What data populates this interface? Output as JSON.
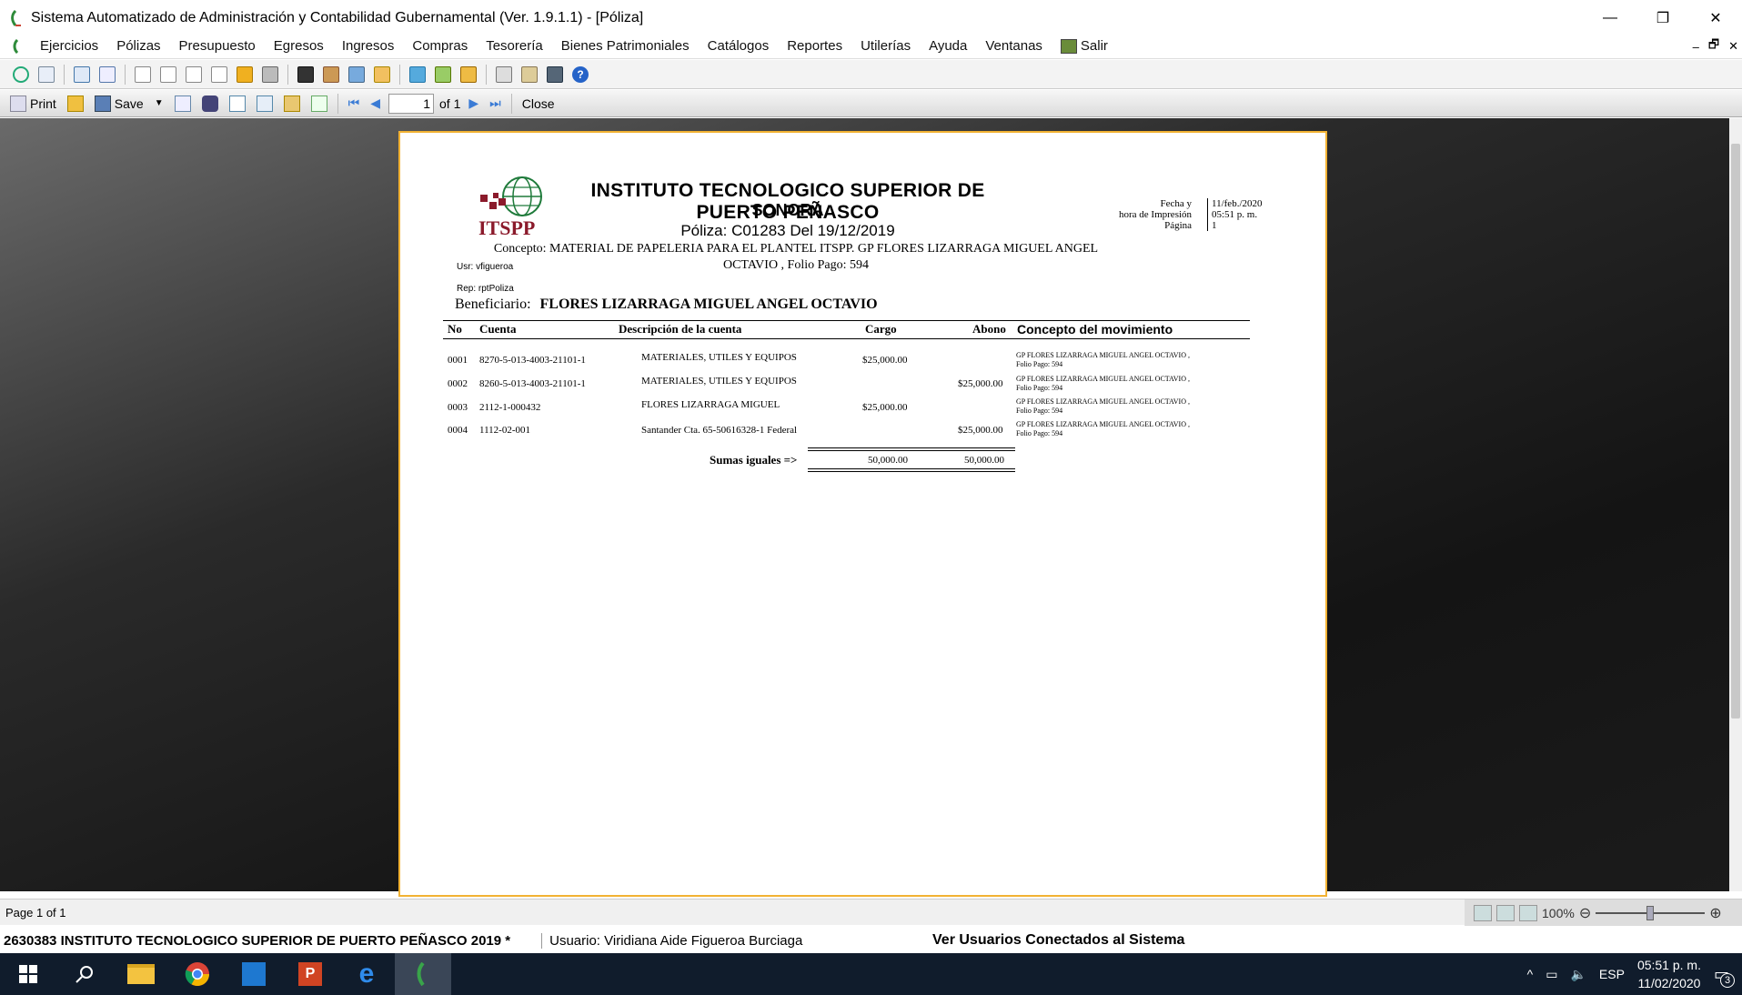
{
  "window": {
    "title": "Sistema Automatizado de Administración y Contabilidad Gubernamental  (Ver. 1.9.1.1) - [Póliza]",
    "minimize": "—",
    "restore": "❐",
    "close": "✕"
  },
  "menu": {
    "items": [
      "Ejercicios",
      "Pólizas",
      "Presupuesto",
      "Egresos",
      "Ingresos",
      "Compras",
      "Tesorería",
      "Bienes Patrimoniales",
      "Catálogos",
      "Reportes",
      "Utilerías",
      "Ayuda",
      "Ventanas",
      "Salir"
    ],
    "mdi_minimize": "–",
    "mdi_restore": "🗗",
    "mdi_close": "✕"
  },
  "report_toolbar": {
    "print": "Print",
    "save": "Save",
    "page_value": "1",
    "of_pages": "of 1",
    "close": "Close"
  },
  "report": {
    "institution": "INSTITUTO TECNOLOGICO SUPERIOR DE PUERTO PEÑASCO",
    "state": "SONORA",
    "poliza_line": "Póliza:  C01283  Del 19/12/2019",
    "logo_text": "ITSPP",
    "meta_labels": [
      "Fecha y",
      "hora de Impresión",
      "Página"
    ],
    "meta_values": [
      "11/feb./2020",
      "05:51 p. m.",
      "1"
    ],
    "concepto_label": "Concepto:",
    "concepto_text": " MATERIAL DE PAPELERIA PARA EL PLANTEL ITSPP. GP FLORES LIZARRAGA MIGUEL ANGEL OCTAVIO , Folio Pago: 594",
    "usr": "Usr: vfigueroa",
    "rep": "Rep: rptPoliza",
    "beneficiario_label": "Beneficiario:",
    "beneficiario": "FLORES LIZARRAGA MIGUEL ANGEL OCTAVIO",
    "headers": {
      "no": "No",
      "cuenta": "Cuenta",
      "descripcion": "Descripción de la cuenta",
      "cargo": "Cargo",
      "abono": "Abono",
      "concepto": "Concepto del movimiento"
    },
    "rows": [
      {
        "no": "0001",
        "cuenta": "8270-5-013-4003-21101-1",
        "descripcion": "MATERIALES, UTILES Y EQUIPOS",
        "cargo": "$25,000.00",
        "abono": "",
        "concepto1": "GP FLORES LIZARRAGA MIGUEL ANGEL OCTAVIO ,",
        "concepto2": "Folio Pago: 594"
      },
      {
        "no": "0002",
        "cuenta": "8260-5-013-4003-21101-1",
        "descripcion": "MATERIALES, UTILES Y EQUIPOS",
        "cargo": "",
        "abono": "$25,000.00",
        "concepto1": "GP FLORES LIZARRAGA MIGUEL ANGEL OCTAVIO ,",
        "concepto2": "Folio Pago: 594"
      },
      {
        "no": "0003",
        "cuenta": "2112-1-000432",
        "descripcion": "FLORES LIZARRAGA MIGUEL",
        "cargo": "$25,000.00",
        "abono": "",
        "concepto1": "GP FLORES LIZARRAGA MIGUEL ANGEL OCTAVIO ,",
        "concepto2": "Folio Pago: 594"
      },
      {
        "no": "0004",
        "cuenta": "1112-02-001",
        "descripcion": "Santander Cta. 65-50616328-1 Federal",
        "cargo": "",
        "abono": "$25,000.00",
        "concepto1": "GP FLORES LIZARRAGA MIGUEL ANGEL OCTAVIO ,",
        "concepto2": "Folio Pago: 594"
      }
    ],
    "sumas_label": "Sumas iguales =>",
    "total_cargo": "50,000.00",
    "total_abono": "50,000.00"
  },
  "status": {
    "page_info": "Page 1 of 1",
    "zoom": "100%"
  },
  "info": {
    "institution": "2630383 INSTITUTO TECNOLOGICO SUPERIOR DE PUERTO PEÑASCO  2019   *",
    "usuario": "Usuario: Viridiana Aide Figueroa Burciaga",
    "ver_usuarios": "Ver Usuarios Conectados al Sistema"
  },
  "taskbar": {
    "lang": "ESP",
    "time": "05:51 p. m.",
    "date": "11/02/2020",
    "notifications": "3"
  },
  "colors": {
    "accent_border": "#f2b233",
    "taskbar": "#101c2c"
  }
}
